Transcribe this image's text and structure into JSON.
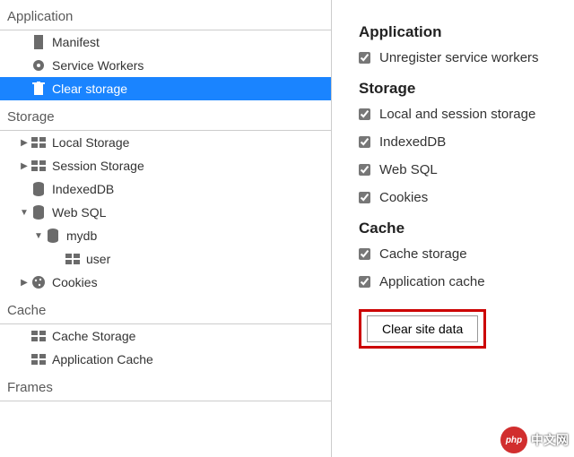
{
  "left": {
    "sections": {
      "application": {
        "header": "Application",
        "items": [
          {
            "label": "Manifest",
            "icon": "file-icon"
          },
          {
            "label": "Service Workers",
            "icon": "gear-icon"
          },
          {
            "label": "Clear storage",
            "icon": "trash-icon",
            "selected": true
          }
        ]
      },
      "storage": {
        "header": "Storage",
        "items": [
          {
            "label": "Local Storage",
            "icon": "storage-icon",
            "expand": "closed"
          },
          {
            "label": "Session Storage",
            "icon": "storage-icon",
            "expand": "closed"
          },
          {
            "label": "IndexedDB",
            "icon": "db-icon"
          },
          {
            "label": "Web SQL",
            "icon": "db-icon",
            "expand": "open"
          },
          {
            "label": "mydb",
            "icon": "db-icon",
            "expand": "open",
            "indent": 2
          },
          {
            "label": "user",
            "icon": "storage-icon",
            "indent": 3
          },
          {
            "label": "Cookies",
            "icon": "cookie-icon",
            "expand": "closed"
          }
        ]
      },
      "cache": {
        "header": "Cache",
        "items": [
          {
            "label": "Cache Storage",
            "icon": "storage-icon"
          },
          {
            "label": "Application Cache",
            "icon": "storage-icon"
          }
        ]
      },
      "frames": {
        "header": "Frames"
      }
    }
  },
  "right": {
    "sections": [
      {
        "title": "Application",
        "options": [
          {
            "label": "Unregister service workers",
            "checked": true
          }
        ]
      },
      {
        "title": "Storage",
        "options": [
          {
            "label": "Local and session storage",
            "checked": true
          },
          {
            "label": "IndexedDB",
            "checked": true
          },
          {
            "label": "Web SQL",
            "checked": true
          },
          {
            "label": "Cookies",
            "checked": true
          }
        ]
      },
      {
        "title": "Cache",
        "options": [
          {
            "label": "Cache storage",
            "checked": true
          },
          {
            "label": "Application cache",
            "checked": true
          }
        ]
      }
    ],
    "clear_button": "Clear site data"
  },
  "watermark": {
    "badge": "php",
    "text": "中文网"
  }
}
